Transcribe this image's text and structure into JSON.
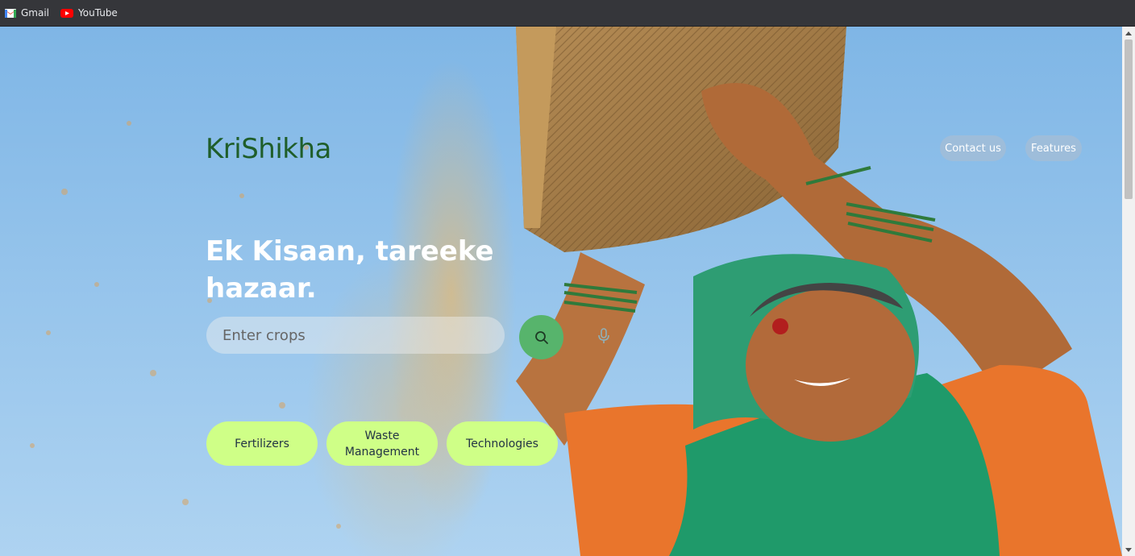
{
  "bookmarks": [
    {
      "label": "Gmail",
      "icon": "gmail-icon"
    },
    {
      "label": "YouTube",
      "icon": "youtube-icon"
    }
  ],
  "site": {
    "logo": "KriShikha",
    "nav": {
      "contact": "Contact us",
      "features": "Features"
    },
    "headline_line1": "Ek Kisaan, tareeke",
    "headline_line2": "hazaar.",
    "search": {
      "placeholder": "Enter crops",
      "button_icon": "search-icon",
      "mic_icon": "microphone-icon"
    },
    "categories": [
      {
        "label": "Fertilizers"
      },
      {
        "label": "Waste Management"
      },
      {
        "label": "Technologies"
      }
    ]
  },
  "colors": {
    "logo": "#1f5e2a",
    "search_button": "#57b46c",
    "category_pill": "#cfff87",
    "sky": "#8ec0ea"
  }
}
